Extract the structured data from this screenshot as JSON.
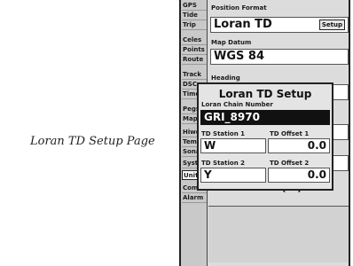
{
  "caption": "Loran TD Setup Page",
  "tabs": [
    "GPS",
    "Tide",
    "Trip",
    "Celes",
    "Points",
    "Route",
    "Track",
    "DSC",
    "Time",
    "Pegs",
    "Map",
    "Hiwc",
    "Temp",
    "Sonar",
    "Syst",
    "Unit",
    "Comm",
    "Alarm"
  ],
  "selected_tab": "Unit",
  "position_format": {
    "label": "Position Format",
    "value": "Loran TD",
    "button": "Setup"
  },
  "map_datum": {
    "label": "Map Datum",
    "value": "WGS 84"
  },
  "heading": {
    "label": "Heading"
  },
  "background_partial_text": "Pur emienc (1 )",
  "popup": {
    "title": "Loran TD Setup",
    "chain_label": "Loran Chain Number",
    "chain_value": "GRI_8970",
    "station1_label": "TD Station 1",
    "station1_value": "W",
    "offset1_label": "TD Offset 1",
    "offset1_value": "0.0",
    "station2_label": "TD Station 2",
    "station2_value": "Y",
    "offset2_label": "TD Offset 2",
    "offset2_value": "0.0"
  }
}
